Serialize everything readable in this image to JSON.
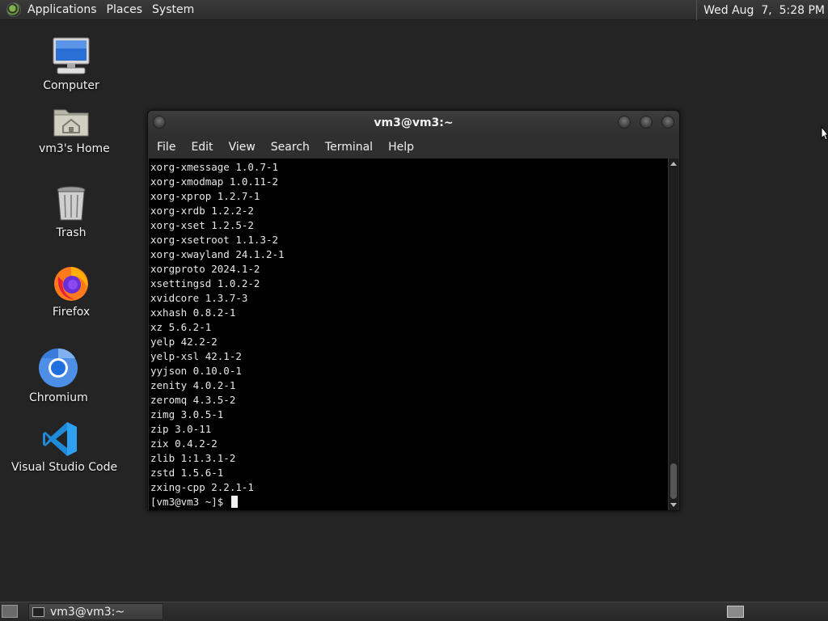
{
  "top_panel": {
    "menus": [
      "Applications",
      "Places",
      "System"
    ],
    "clock": "Wed Aug  7,  5:28 PM"
  },
  "desktop_icons": [
    {
      "label": "Computer",
      "icon": "computer-icon"
    },
    {
      "label": "vm3's Home",
      "icon": "home-folder-icon"
    },
    {
      "label": "Trash",
      "icon": "trash-icon"
    },
    {
      "label": "Firefox",
      "icon": "firefox-icon"
    },
    {
      "label": "Chromium",
      "icon": "chromium-icon"
    },
    {
      "label": "Visual Studio Code",
      "icon": "vscode-icon"
    }
  ],
  "terminal": {
    "title": "vm3@vm3:~",
    "menu": [
      "File",
      "Edit",
      "View",
      "Search",
      "Terminal",
      "Help"
    ],
    "lines": [
      "xorg-xmessage 1.0.7-1",
      "xorg-xmodmap 1.0.11-2",
      "xorg-xprop 1.2.7-1",
      "xorg-xrdb 1.2.2-2",
      "xorg-xset 1.2.5-2",
      "xorg-xsetroot 1.1.3-2",
      "xorg-xwayland 24.1.2-1",
      "xorgproto 2024.1-2",
      "xsettingsd 1.0.2-2",
      "xvidcore 1.3.7-3",
      "xxhash 0.8.2-1",
      "xz 5.6.2-1",
      "yelp 42.2-2",
      "yelp-xsl 42.1-2",
      "yyjson 0.10.0-1",
      "zenity 4.0.2-1",
      "zeromq 4.3.5-2",
      "zimg 3.0.5-1",
      "zip 3.0-11",
      "zix 0.4.2-2",
      "zlib 1:1.3.1-2",
      "zstd 1.5.6-1",
      "zxing-cpp 2.2.1-1"
    ],
    "prompt": "[vm3@vm3 ~]$ "
  },
  "taskbar": {
    "window_button": "vm3@vm3:~"
  }
}
